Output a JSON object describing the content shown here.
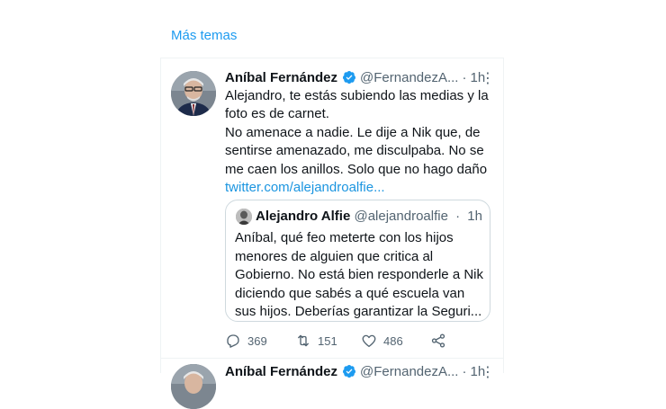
{
  "more_topics": "Más temas",
  "tweet": {
    "name": "Aníbal Fernández",
    "handle": "@FernandezA...",
    "separator": "·",
    "time": "1h",
    "lines": [
      "Alejandro, te estás subiendo las medias y la foto es de carnet.",
      "No amenace a nadie. Le dije a Nik que, de sentirse amenazado, me disculpaba. No se me caen los anillos. Solo que no hago daño"
    ],
    "link": "twitter.com/alejandroalfie...",
    "quote": {
      "name": "Alejandro Alfie",
      "handle": "@alejandroalfie",
      "separator": "·",
      "time": "1h",
      "text": "Aníbal, qué feo meterte con los hijos menores de alguien que critica al Gobierno. No está bien responderle a Nik diciendo que sabés a qué escuela van sus hijos. Deberías garantizar la Seguri..."
    },
    "stats": {
      "replies": "369",
      "retweets": "151",
      "likes": "486"
    }
  },
  "next_tweet": {
    "name": "Aníbal Fernández",
    "handle": "@FernandezA...",
    "separator": "·",
    "time": "1h"
  },
  "colors": {
    "link": "#1d9bf0",
    "verified": "#1d9bf0",
    "muted_text": "#536471"
  },
  "icons": {
    "verified": "verified-badge-icon",
    "more": "more-options-icon",
    "reply": "reply-icon",
    "retweet": "retweet-icon",
    "like": "heart-icon",
    "share": "share-icon"
  }
}
